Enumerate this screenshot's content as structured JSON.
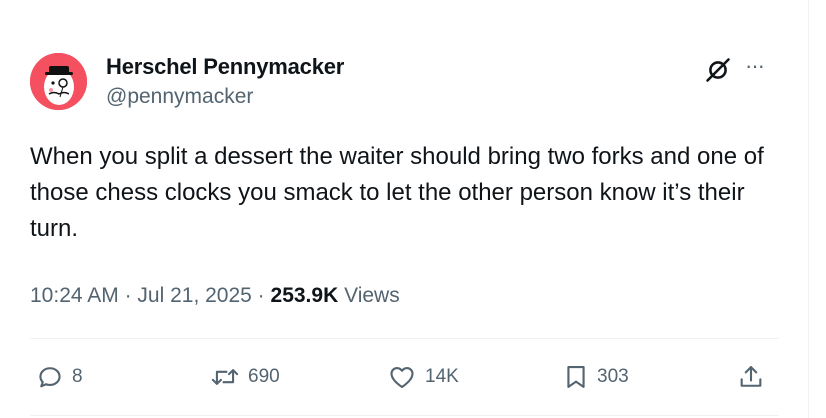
{
  "author": {
    "name": "Herschel Pennymacker",
    "handle": "@pennymacker"
  },
  "header_icons": {
    "grok": "grok-icon",
    "more": "···"
  },
  "tweet": {
    "text": "When you split a dessert the waiter should bring two forks and one of those chess clocks you smack to let the other person know it’s their turn."
  },
  "meta": {
    "time": "10:24 AM",
    "separator": " · ",
    "date": "Jul 21, 2025",
    "views_count": "253.9K",
    "views_label": " Views"
  },
  "actions": {
    "reply": {
      "icon": "reply-icon",
      "count": "8"
    },
    "repost": {
      "icon": "repost-icon",
      "count": "690"
    },
    "like": {
      "icon": "heart-icon",
      "count": "14K"
    },
    "bookmark": {
      "icon": "bookmark-icon",
      "count": "303"
    },
    "share": {
      "icon": "share-icon"
    }
  },
  "colors": {
    "text": "#0f1419",
    "secondary": "#536471",
    "avatar_bg": "#f4505f",
    "divider": "#eff3f4"
  }
}
